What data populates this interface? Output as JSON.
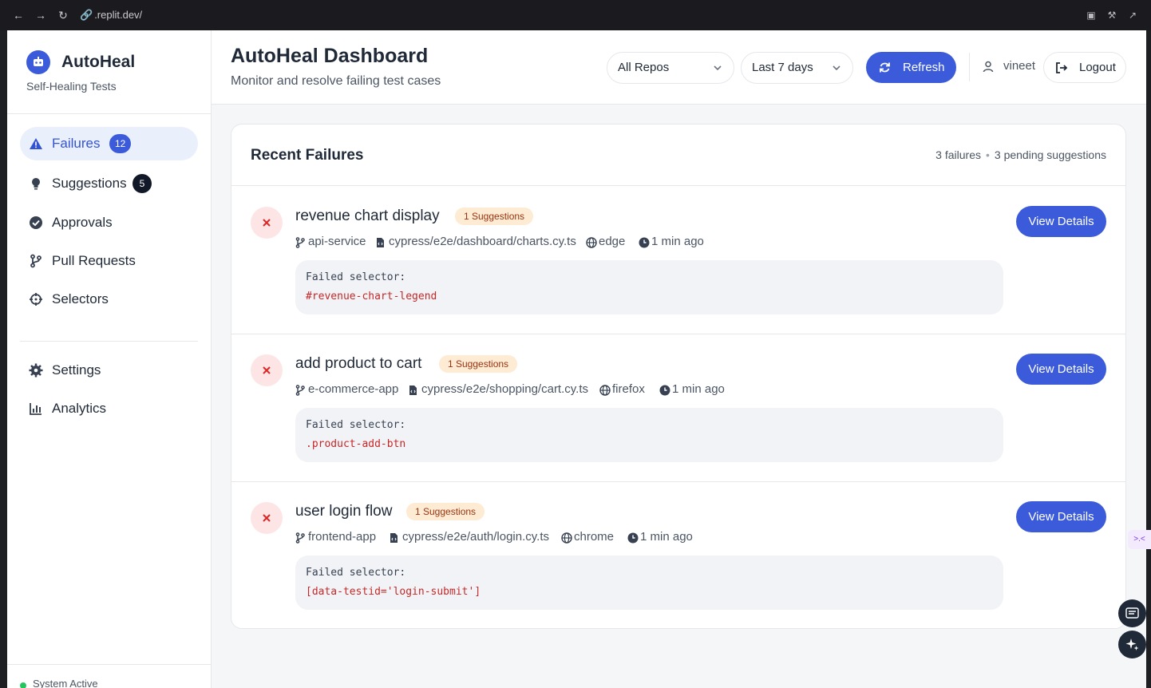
{
  "browser": {
    "url": ".replit.dev/"
  },
  "sidebar": {
    "brand_name": "AutoHeal",
    "brand_subtitle": "Self-Healing Tests",
    "items": [
      {
        "label": "Failures",
        "badge": "12",
        "active": true
      },
      {
        "label": "Suggestions",
        "badge": "5",
        "active": false
      },
      {
        "label": "Approvals",
        "badge": "",
        "active": false
      },
      {
        "label": "Pull Requests",
        "badge": "",
        "active": false
      },
      {
        "label": "Selectors",
        "badge": "",
        "active": false
      },
      {
        "label": "Settings",
        "badge": "",
        "active": false
      },
      {
        "label": "Analytics",
        "badge": "",
        "active": false
      }
    ],
    "status": "System Active"
  },
  "header": {
    "title": "AutoHeal Dashboard",
    "subtitle": "Monitor and resolve failing test cases",
    "repo_select": "All Repos",
    "range_select": "Last 7 days",
    "refresh_label": "Refresh",
    "username": "vineet",
    "logout_label": "Logout"
  },
  "failures_card": {
    "title": "Recent Failures",
    "count_text": "3 failures",
    "pending_text": "3 pending suggestions",
    "rows": [
      {
        "title": "revenue chart display",
        "badge": "1 Suggestions",
        "repo": "api-service",
        "file": "cypress/e2e/dashboard/charts.cy.ts",
        "browser": "edge",
        "time": "1 min ago",
        "failed_label": "Failed selector:",
        "selector": "#revenue-chart-legend",
        "action": "View Details"
      },
      {
        "title": "add product to cart",
        "badge": "1 Suggestions",
        "repo": "e-commerce-app",
        "file": "cypress/e2e/shopping/cart.cy.ts",
        "browser": "firefox",
        "time": "1 min ago",
        "failed_label": "Failed selector:",
        "selector": ".product-add-btn",
        "action": "View Details"
      },
      {
        "title": "user login flow",
        "badge": "1 Suggestions",
        "repo": "frontend-app",
        "file": "cypress/e2e/auth/login.cy.ts",
        "browser": "chrome",
        "time": "1 min ago",
        "failed_label": "Failed selector:",
        "selector": "[data-testid='login-submit']",
        "action": "View Details"
      }
    ]
  },
  "colors": {
    "accent": "#3b5bdb",
    "danger": "#c62828",
    "badge_bg": "#fdebd3",
    "success": "#22c55e"
  }
}
